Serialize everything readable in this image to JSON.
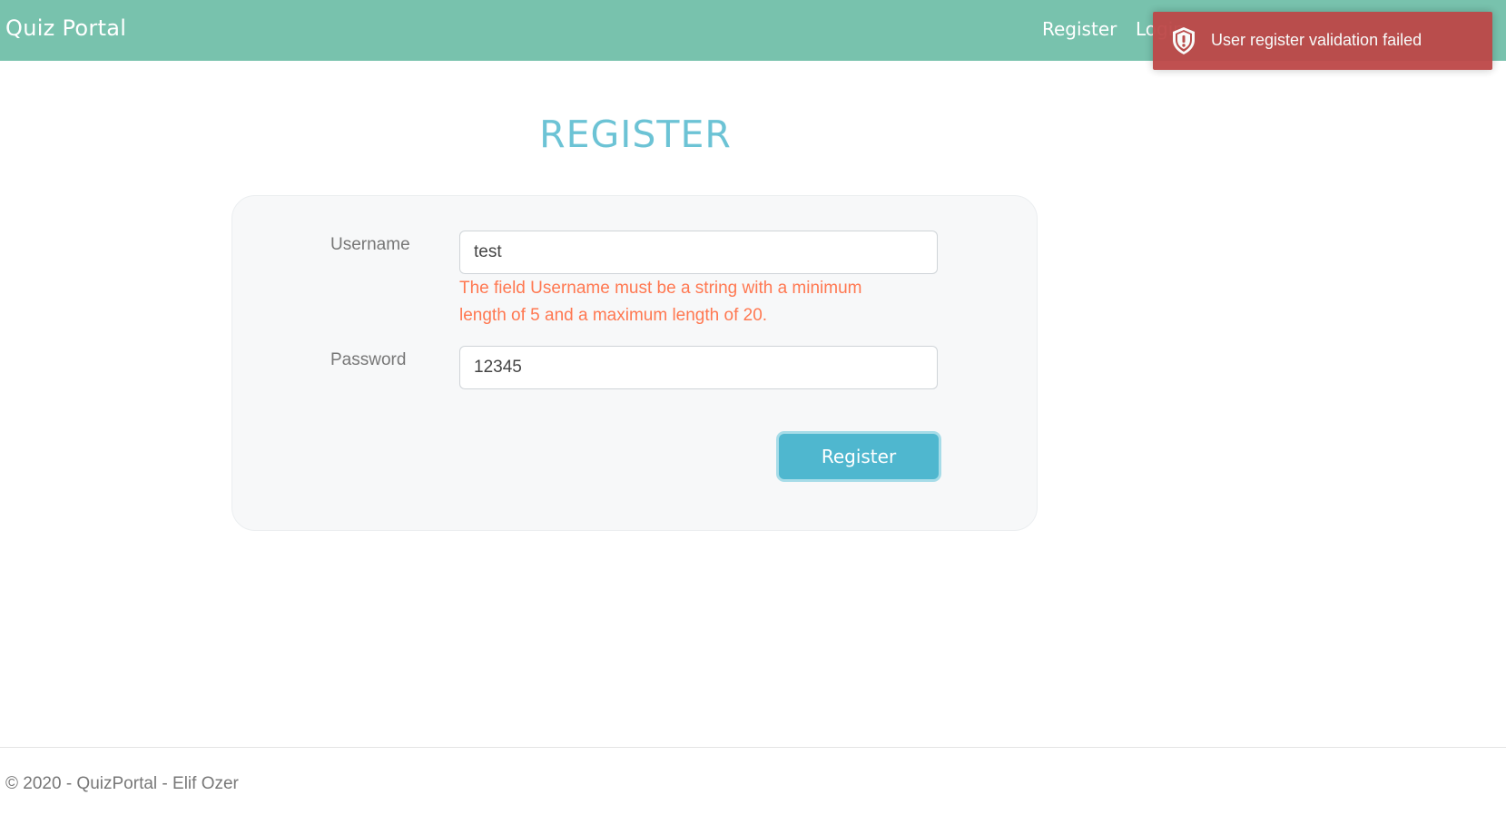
{
  "navbar": {
    "brand": "Quiz Portal",
    "links": [
      "Register",
      "Login"
    ]
  },
  "toast": {
    "message": "User register validation failed",
    "icon": "shield-exclamation-icon",
    "color": "#bd4747"
  },
  "page": {
    "title": "REGISTER"
  },
  "form": {
    "username_label": "Username",
    "username_value": "test",
    "username_error": "The field Username must be a string with a minimum length of 5 and a maximum length of 20.",
    "password_label": "Password",
    "password_value": "12345",
    "submit_label": "Register"
  },
  "footer": {
    "text": "© 2020 - QuizPortal - Elif Ozer"
  },
  "colors": {
    "navbar": "#78c2ad",
    "title": "#6cc3d5",
    "error": "#ff7851",
    "button": "#4fb7cf"
  }
}
